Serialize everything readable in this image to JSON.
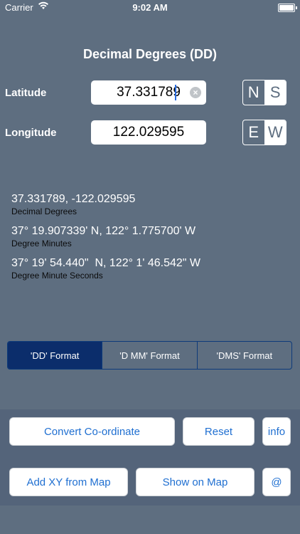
{
  "status": {
    "carrier": "Carrier",
    "time": "9:02 AM"
  },
  "title": "Decimal Degrees (DD)",
  "latitude": {
    "label": "Latitude",
    "value": "37.331789",
    "ns_toggle": [
      "N",
      "S"
    ],
    "selected": "S"
  },
  "longitude": {
    "label": "Longitude",
    "value": "122.029595",
    "ew_toggle": [
      "E",
      "W"
    ],
    "selected": "W"
  },
  "results": [
    {
      "value": "37.331789, -122.029595",
      "caption": "Decimal Degrees"
    },
    {
      "value": "37° 19.907339' N, 122° 1.775700' W",
      "caption": "Degree Minutes"
    },
    {
      "value": "37° 19' 54.440\"  N, 122° 1' 46.542\" W",
      "caption": "Degree Minute Seconds"
    }
  ],
  "formats": [
    "'DD' Format",
    "'D MM' Format",
    "'DMS' Format"
  ],
  "selected_format": "'DD' Format",
  "buttons": {
    "convert": "Convert Co-ordinate",
    "reset": "Reset",
    "info": "info",
    "add_xy": "Add XY from Map",
    "show_map": "Show on Map",
    "at": "@"
  },
  "colors": {
    "background": "#5e6e80",
    "accent": "#1f6fd1",
    "selected_tab": "#0b2d6b"
  }
}
